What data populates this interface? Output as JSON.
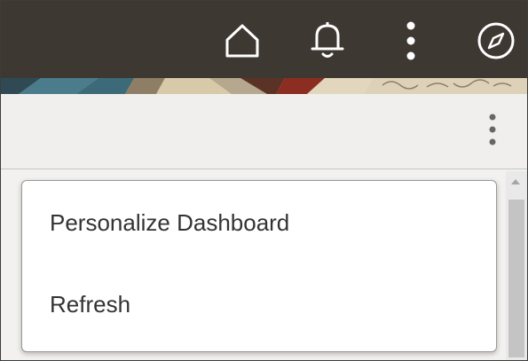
{
  "header": {
    "bg_color": "#3e3833",
    "icons": [
      {
        "name": "home-icon",
        "label": "Home"
      },
      {
        "name": "bell-icon",
        "label": "Notifications"
      },
      {
        "name": "more-vertical-icon",
        "label": "Actions"
      },
      {
        "name": "compass-icon",
        "label": "Navigator"
      }
    ]
  },
  "subheader": {
    "actions_icon": "more-vertical-icon"
  },
  "dropdown": {
    "items": [
      {
        "label": "Personalize Dashboard"
      },
      {
        "label": "Refresh"
      }
    ]
  }
}
